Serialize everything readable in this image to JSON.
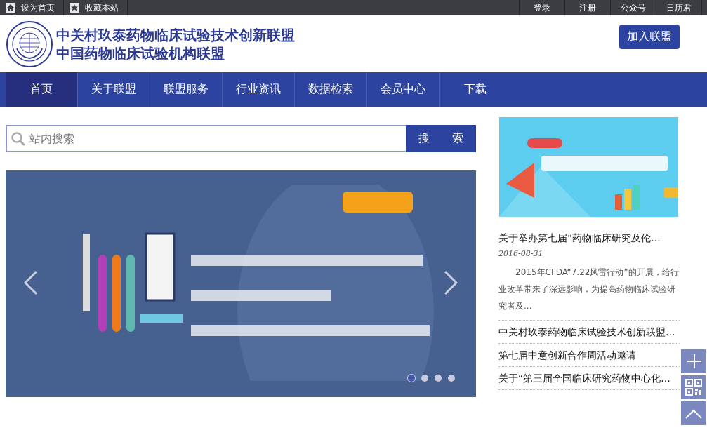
{
  "top_bar": {
    "left_links": [
      {
        "kind": "home",
        "label": "设为首页"
      },
      {
        "kind": "star",
        "label": "收藏本站"
      }
    ],
    "right_links": [
      "登录",
      "注册",
      "公众号",
      "日历君"
    ]
  },
  "header": {
    "title_lines": [
      "中关村玖泰药物临床试验技术创新联盟",
      "中国药物临床试验机构联盟"
    ],
    "join_button": "加入联盟"
  },
  "nav": [
    {
      "label": "首页",
      "selected": true
    },
    {
      "label": "关于联盟",
      "selected": false
    },
    {
      "label": "联盟服务",
      "selected": false
    },
    {
      "label": "行业资讯",
      "selected": false
    },
    {
      "label": "数据检索",
      "selected": false
    },
    {
      "label": "会员中心",
      "selected": false
    },
    {
      "label": "下载",
      "selected": false
    }
  ],
  "search": {
    "placeholder": "站内搜索",
    "button": "搜　　索"
  },
  "slider": {
    "dots": [
      {
        "selected": true
      },
      {
        "selected": false
      },
      {
        "selected": false
      },
      {
        "selected": false
      }
    ]
  },
  "news": {
    "featured": {
      "title": "关于举办第七届“药物临床研究及伦...",
      "date": "2016-08-31",
      "summary": "2015年CFDA“7.22风雷行动”的开展，给行业改革带来了深远影响，为提高药物临床试验研究者及..."
    },
    "items": [
      "中关村玖泰药物临床试验技术创新联盟...",
      "第七届中意创新合作周活动邀请",
      "关于“第三届全国临床研究药物中心化..."
    ]
  },
  "float_tools": [
    {
      "kind": "plus"
    },
    {
      "kind": "qr"
    },
    {
      "kind": "top"
    }
  ]
}
